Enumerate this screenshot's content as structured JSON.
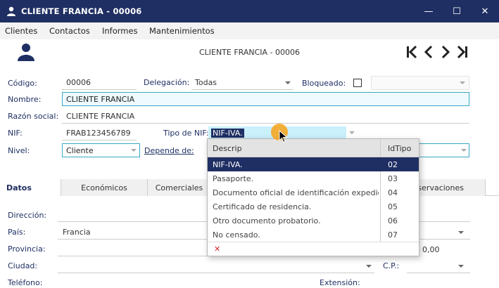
{
  "window": {
    "title": "CLIENTE FRANCIA - 00006",
    "minimize": "—",
    "maximize": "☐",
    "close": "✕"
  },
  "menu": {
    "items": [
      "Clientes",
      "Contactos",
      "Informes",
      "Mantenimientos"
    ]
  },
  "header": {
    "title": "CLIENTE FRANCIA - 00006"
  },
  "form": {
    "codigo_label": "Código:",
    "codigo_value": "00006",
    "delegacion_label": "Delegación:",
    "delegacion_value": "Todas",
    "bloqueado_label": "Bloqueado:",
    "nombre_label": "Nombre:",
    "nombre_value": "CLIENTE FRANCIA",
    "razon_label": "Razón social:",
    "razon_value": "CLIENTE FRANCIA",
    "nif_label": "NIF:",
    "nif_value": "FRAB123456789",
    "tiponif_label": "Tipo de NIF:",
    "tiponif_value": "NIF-IVA.",
    "nivel_label": "Nivel:",
    "nivel_value": "Cliente",
    "depende_label": "Depende de:"
  },
  "tabs": [
    "Datos",
    "Económicos",
    "Comerciales",
    "Observaciones"
  ],
  "dropdown": {
    "col_descrip": "Descrip",
    "col_idtipo": "IdTipo",
    "rows": [
      {
        "descrip": "NIF-IVA.",
        "id": "02"
      },
      {
        "descrip": "Pasaporte.",
        "id": "03"
      },
      {
        "descrip": "Documento oficial de identificación expedid…",
        "id": "04"
      },
      {
        "descrip": "Certificado de residencia.",
        "id": "05"
      },
      {
        "descrip": "Otro documento probatorio.",
        "id": "06"
      },
      {
        "descrip": "No censado.",
        "id": "07"
      }
    ],
    "clear_symbol": "✕"
  },
  "datos": {
    "direccion_label": "Dirección:",
    "pais_label": "País:",
    "pais_value": "Francia",
    "provincia_label": "Provincia:",
    "ciudad_label": "Ciudad:",
    "cp_label": "C.P.:",
    "telefono_label": "Teléfono:",
    "extension_label": "Extensión:",
    "amount_value": "0,00"
  },
  "colors": {
    "titlebar": "#1f2f63",
    "accent": "#38a8c7",
    "cursor_highlight": "#f5a623"
  }
}
